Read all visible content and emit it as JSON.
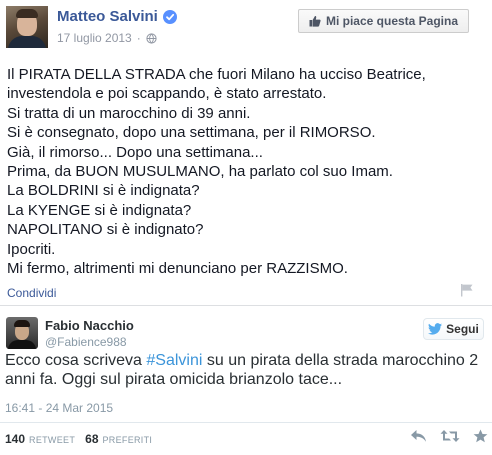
{
  "facebook_post": {
    "author": "Matteo Salvini",
    "date": "17 luglio 2013",
    "date_separator": "·",
    "like_page_label": "Mi piace questa Pagina",
    "lines": [
      "Il PIRATA DELLA STRADA che fuori Milano ha ucciso Beatrice,",
      "investendola e poi scappando, è stato arrestato.",
      "Si tratta di un marocchino di 39 anni.",
      "Si è consegnato, dopo una settimana, per il RIMORSO.",
      "Già, il rimorso... Dopo una settimana...",
      "Prima, da BUON MUSULMANO, ha parlato col suo Imam.",
      "La BOLDRINI si è indignata?",
      "La KYENGE si è indignata?",
      "NAPOLITANO si è indignato?",
      "Ipocriti.",
      "Mi fermo, altrimenti mi denunciano per RAZZISMO."
    ],
    "share_label": "Condividi",
    "icons": {
      "verified": "verified-badge-icon",
      "globe": "globe-icon",
      "like": "thumbs-up-icon",
      "report": "flag-icon"
    }
  },
  "tweet": {
    "name": "Fabio Nacchio",
    "handle": "@Fabience988",
    "follow_label": "Segui",
    "text_before": "Ecco cosa scriveva ",
    "hashtag": "#Salvini",
    "text_after": " su un pirata della strada marocchino 2 anni fa. Oggi sul pirata omicida brianzolo tace...",
    "timestamp": "16:41 - 24 Mar 2015",
    "retweet_count": "140",
    "retweet_label": "RETWEET",
    "favorite_count": "68",
    "favorite_label": "PREFERITI",
    "icons": {
      "bird": "twitter-bird-icon",
      "reply": "reply-icon",
      "retweet": "retweet-icon",
      "favorite": "star-icon"
    }
  },
  "colors": {
    "facebook_blue": "#3b5998",
    "twitter_link": "#3b94d9",
    "twitter_blue": "#55acee",
    "muted": "#8899a6"
  }
}
